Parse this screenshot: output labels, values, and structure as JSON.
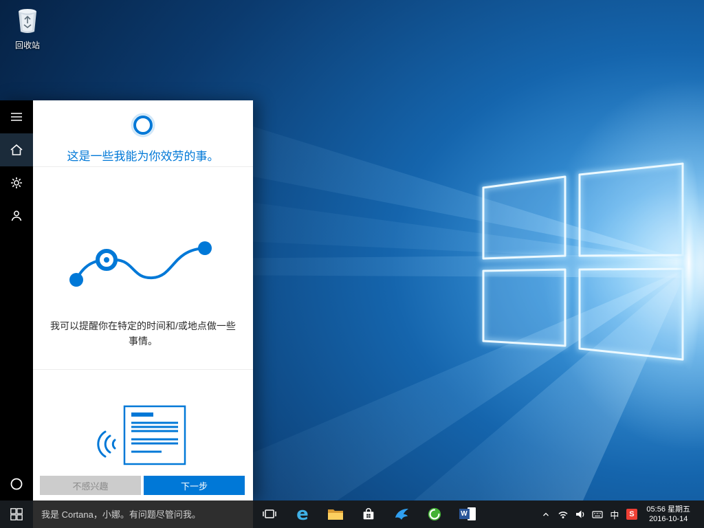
{
  "desktop": {
    "recycle_bin": {
      "label": "回收站"
    }
  },
  "cortana": {
    "panel": {
      "title": "这是一些我能为你效劳的事。",
      "cards": [
        {
          "text": "我可以提醒你在特定的时间和/或地点做一些事情。"
        }
      ],
      "buttons": {
        "decline": "不感兴趣",
        "next": "下一步"
      }
    },
    "search_box": {
      "placeholder": "我是 Cortana，小娜。有问题尽管问我。"
    }
  },
  "taskbar": {
    "icons": {
      "edge_letter": "e",
      "word_letter": "W"
    },
    "tray": {
      "ime": "中",
      "sogou_letter": "S",
      "time": "05:56 星期五",
      "date": "2016-10-14"
    }
  },
  "colors": {
    "accent": "#0078d7",
    "gray_button": "#cccccc",
    "taskbar_bg": "#171b1f",
    "panel_bg": "#ffffff"
  }
}
